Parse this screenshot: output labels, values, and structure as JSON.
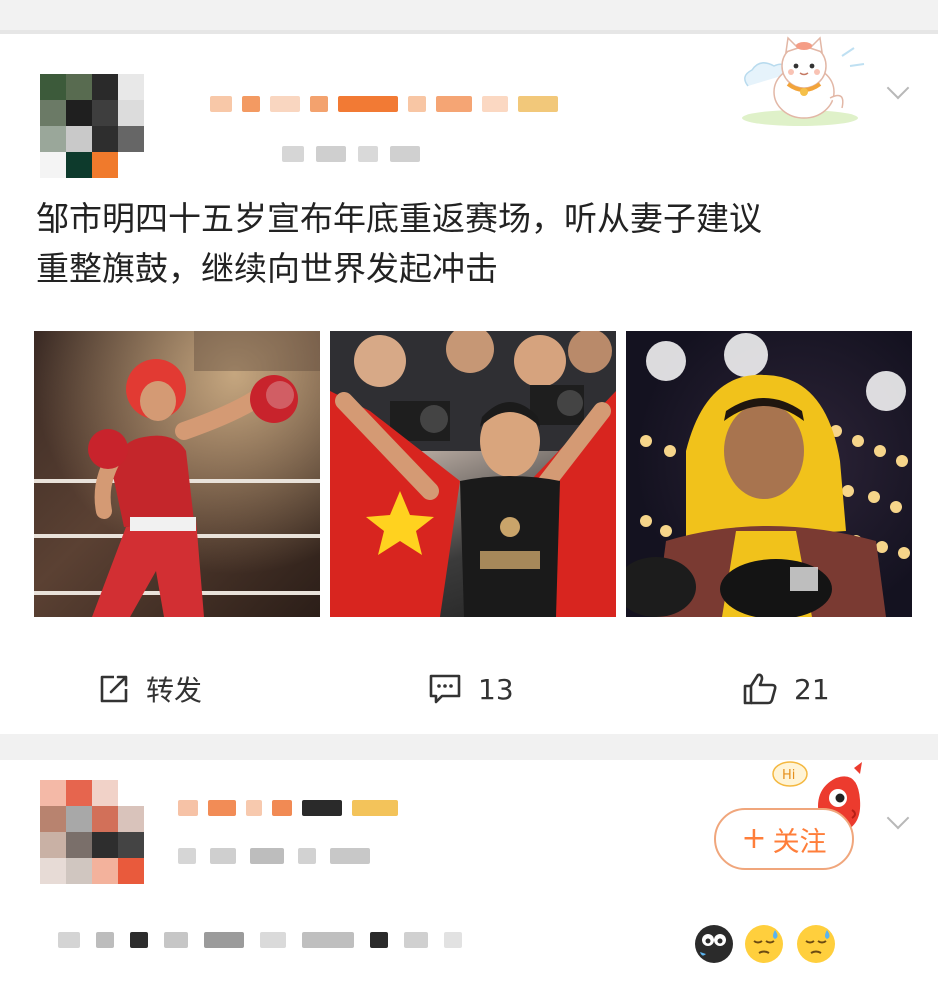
{
  "feed": {
    "post1": {
      "text_line1": "邹市明四十五岁宣布年底重返赛场，听从妻子建议",
      "text_line2": "重整旗鼓，继续向世界发起冲击",
      "repost_label": "转发",
      "comments_count": "13",
      "likes_count": "21",
      "icons": [
        "repost-icon",
        "comment-icon",
        "like-icon",
        "chevron-down-icon",
        "cat-sticker"
      ]
    },
    "post2": {
      "follow_label": "关注",
      "follow_plus": "+",
      "badge_text": "Hi",
      "icons": [
        "chevron-down-icon",
        "mascot-sticker"
      ]
    }
  },
  "colors": {
    "accent": "#ff7e3a",
    "follow_border": "#f0a67c",
    "text_primary": "#222222",
    "divider": "#f1f1f1"
  }
}
